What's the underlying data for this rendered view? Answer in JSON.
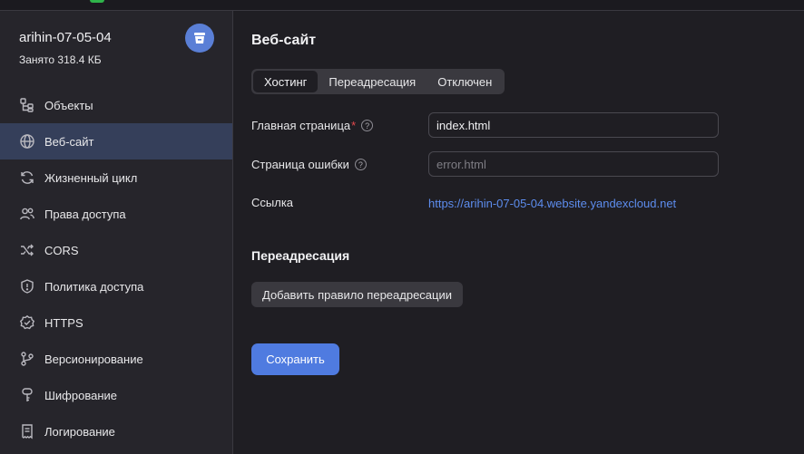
{
  "colors": {
    "accent": "#4f7be0",
    "link": "#5d8dee",
    "active_nav": "#353f5a",
    "required": "#e5484d"
  },
  "bucket": {
    "name": "arihin-07-05-04",
    "used": "Занято 318.4 КБ",
    "avatar_icon": "bucket-icon"
  },
  "sidebar": {
    "items": [
      {
        "label": "Объекты",
        "icon": "objects-tree-icon"
      },
      {
        "label": "Веб-сайт",
        "icon": "globe-icon"
      },
      {
        "label": "Жизненный цикл",
        "icon": "cycle-icon"
      },
      {
        "label": "Права доступа",
        "icon": "users-icon"
      },
      {
        "label": "CORS",
        "icon": "shuffle-icon"
      },
      {
        "label": "Политика доступа",
        "icon": "shield-icon"
      },
      {
        "label": "HTTPS",
        "icon": "check-badge-icon"
      },
      {
        "label": "Версионирование",
        "icon": "branch-icon"
      },
      {
        "label": "Шифрование",
        "icon": "key-icon"
      },
      {
        "label": "Логирование",
        "icon": "log-icon"
      }
    ],
    "active_index": 1
  },
  "main": {
    "title": "Веб-сайт",
    "tabs": [
      {
        "label": "Хостинг"
      },
      {
        "label": "Переадресация"
      },
      {
        "label": "Отключен"
      }
    ],
    "active_tab": 0,
    "main_page": {
      "label": "Главная страница",
      "required_mark": "*",
      "value": "index.html"
    },
    "error_page": {
      "label": "Страница ошибки",
      "value": "",
      "placeholder": "error.html"
    },
    "link": {
      "label": "Ссылка",
      "url": "https://arihin-07-05-04.website.yandexcloud.net"
    },
    "redirect": {
      "title": "Переадресация",
      "add_button": "Добавить правило переадресации"
    },
    "save_button": "Сохранить"
  }
}
